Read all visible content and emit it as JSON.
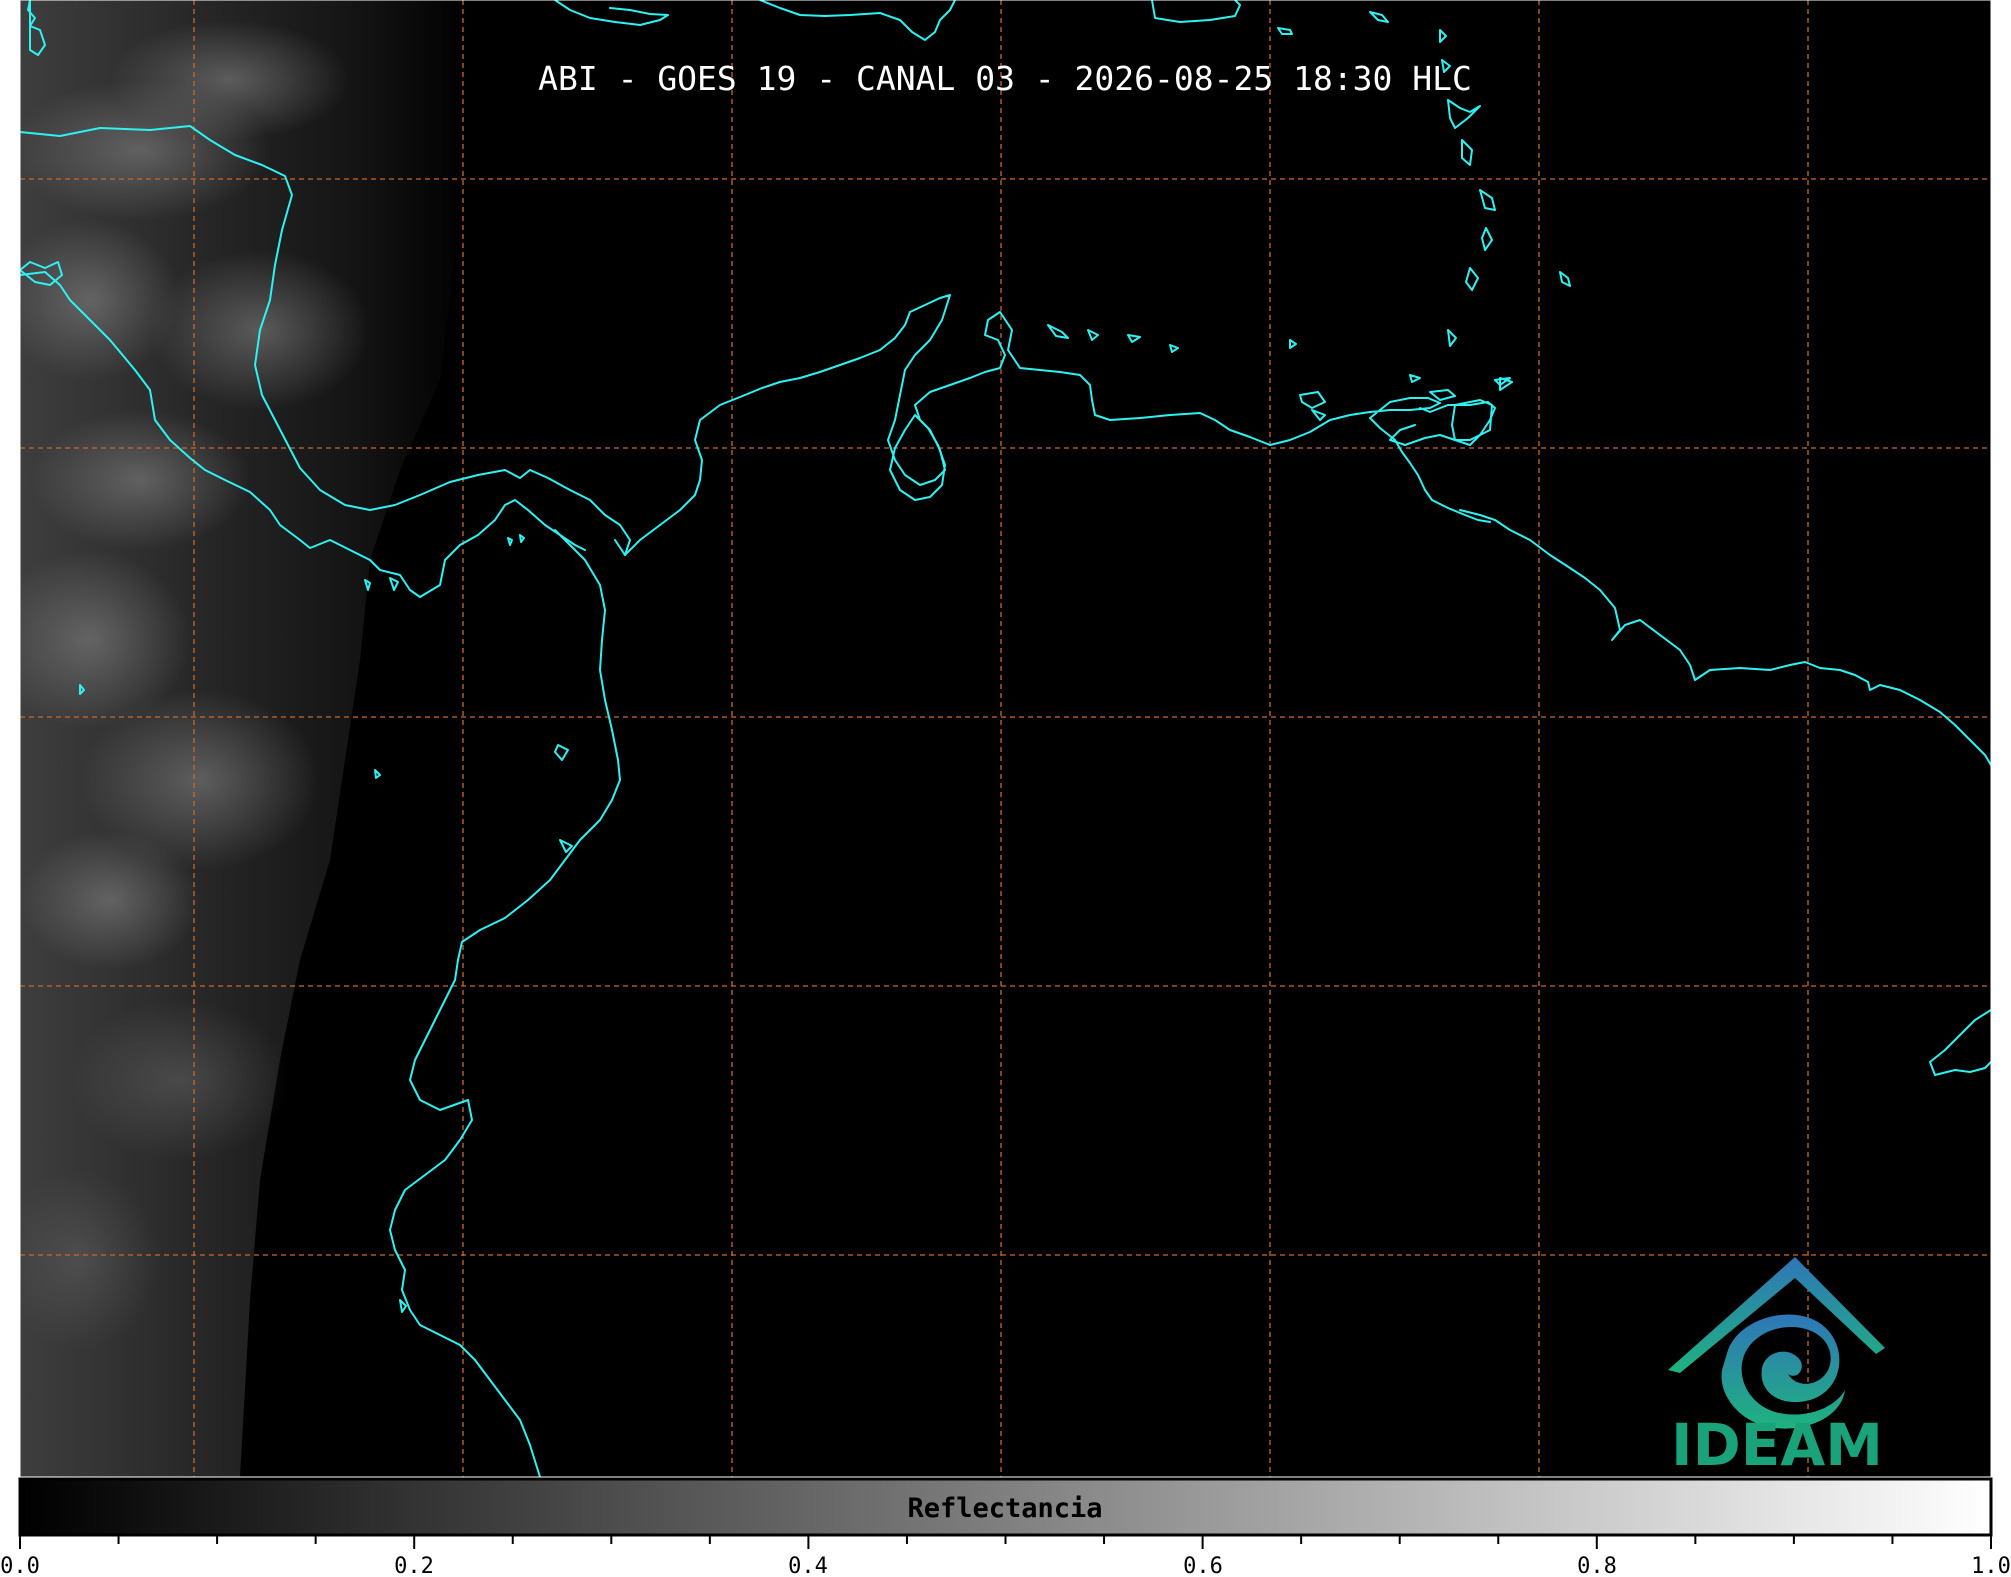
{
  "map": {
    "title": "ABI - GOES 19 - CANAL 03 - 2026-08-25 18:30 HLC",
    "background_color": "#000000",
    "coastline_color": "#2ef2f2",
    "grid_color": "#c8692a"
  },
  "colorbar": {
    "label": "Reflectancia",
    "min": 0.0,
    "max": 1.0,
    "tick_labels": [
      "0.0",
      "0.2",
      "0.4",
      "0.6",
      "0.8",
      "1.0"
    ],
    "colors": [
      "#000000",
      "#ffffff"
    ]
  },
  "logo": {
    "text": "IDEAM",
    "color_top": "#2f76b8",
    "color_bottom": "#1fb27e"
  }
}
